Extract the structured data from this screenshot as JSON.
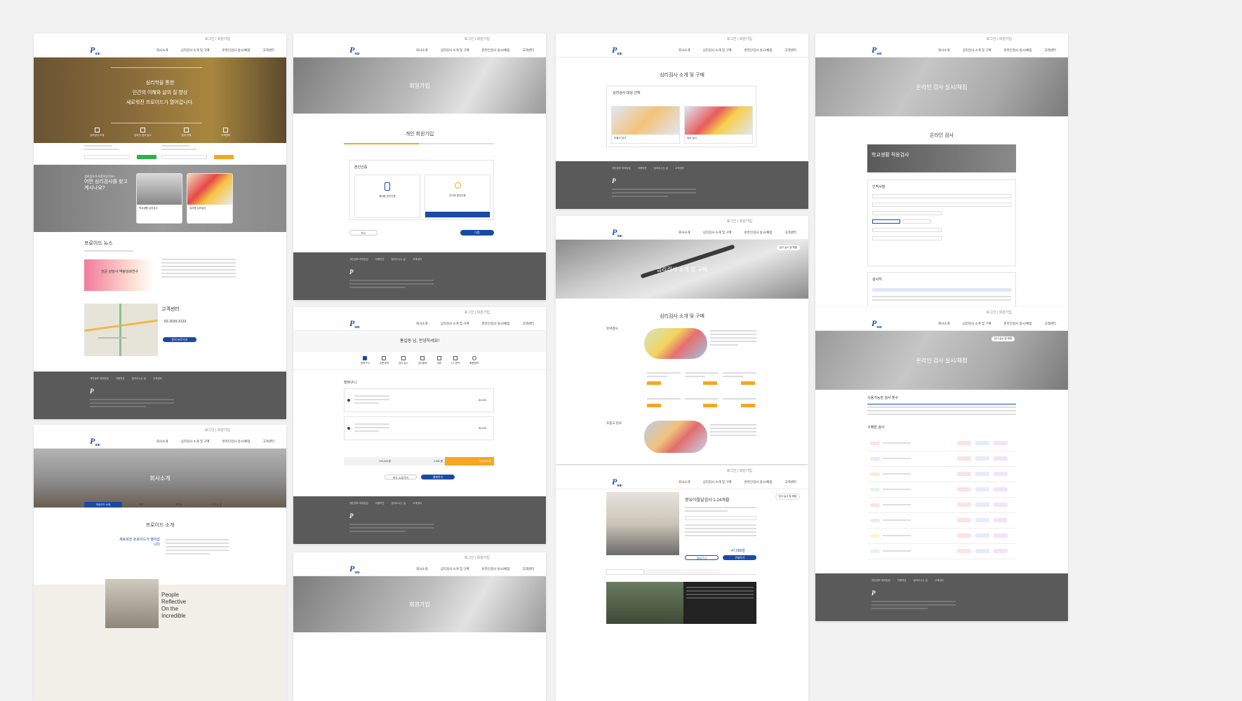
{
  "brand": {
    "logo": "P",
    "logo_sub": "ROID"
  },
  "nav": [
    "회사소개",
    "심리검사 소개 및 구매",
    "온라인검사 실시/채점",
    "고객센터"
  ],
  "topbar_text": "로그인 | 회원가입",
  "footer": {
    "nav": [
      "개인정보 처리방침",
      "이용약관",
      "찾아오시는 길",
      "고객센터"
    ]
  },
  "shot1": {
    "hero_lines": [
      "심리학을 통한",
      "인간의 이해와 삶의 질 향상",
      "새로워진 프로이드가 열어갑니다."
    ],
    "hero_icons": [
      "심리검사 소개",
      "온라인 검사 실시",
      "검사 구매",
      "고객센터"
    ],
    "search_title": "어떤 심리검사를 찾고 계시나요?",
    "search_sub": "심리검사가 처음이신가요?",
    "cards": [
      "학교생활 심리검사",
      "유아용 심리검사"
    ],
    "news_title": "프로이드 뉴스",
    "news_banner": "전문 상담사 역량강화연수",
    "cs_title": "고객센터",
    "cs_phone": "02-2039-3133",
    "cs_button": "문의 바로가기"
  },
  "shot2": {
    "hero": "회사소개",
    "tabs": [
      "프로이드 소개",
      "연혁",
      "조직도",
      "오시는 길"
    ],
    "title": "프로이드 소개",
    "subtitle": "새로워진 프로이드가 열어갑니다",
    "slogan": [
      "People",
      "Reflective",
      "On the",
      "Incredible"
    ]
  },
  "shot3": {
    "hero": "회원가입",
    "title": "개인 회원가입",
    "box_title": "본인인증",
    "opts": [
      "휴대폰 본인인증",
      "아이핀 본인인증"
    ],
    "buttons": [
      "취소",
      "다음"
    ]
  },
  "shot4": {
    "greeting": "홍길동 님, 안녕하세요!",
    "icons": [
      "장바구니",
      "주문내역",
      "검사 실시",
      "검사결과",
      "쿠폰",
      "1:1 문의",
      "회원정보"
    ],
    "cart_title": "장바구니",
    "price1": "80,000",
    "price2": "80,000",
    "total_left": "129,000 원",
    "total_mid": "2,500 원",
    "total_right": "126,500 원",
    "buttons": [
      "계속 쇼핑하기",
      "결제하기"
    ]
  },
  "shot5": {
    "hero": "회원가입"
  },
  "shot6": {
    "title": "심리검사 소개 및 구매",
    "box_title": "심리검사 대상 선택",
    "options": [
      "초중고 검사",
      "유아 검사"
    ]
  },
  "shot7": {
    "hero": "심리검사 소개 및 구매",
    "title": "심리검사 소개 및 구매",
    "sec1": "유아검사",
    "sec2": "초중고 검사"
  },
  "shot8": {
    "product": "영유아발달검사 1-24개월",
    "price": "47,000원",
    "buttons": [
      "장바구니",
      "구매하기"
    ]
  },
  "shot9": {
    "hero": "온라인 검사 실시/채점",
    "title": "온라인 검사",
    "banner": "학교생활 적응검사",
    "info_title": "인적사항",
    "sheet_title": "검사지"
  },
  "shot10": {
    "hero": "온라인 검사 실시/채점",
    "count_title": "사용가능한 검사 횟수",
    "list_title": "구매한 검사",
    "chip": "검사 실시 및 채점"
  }
}
